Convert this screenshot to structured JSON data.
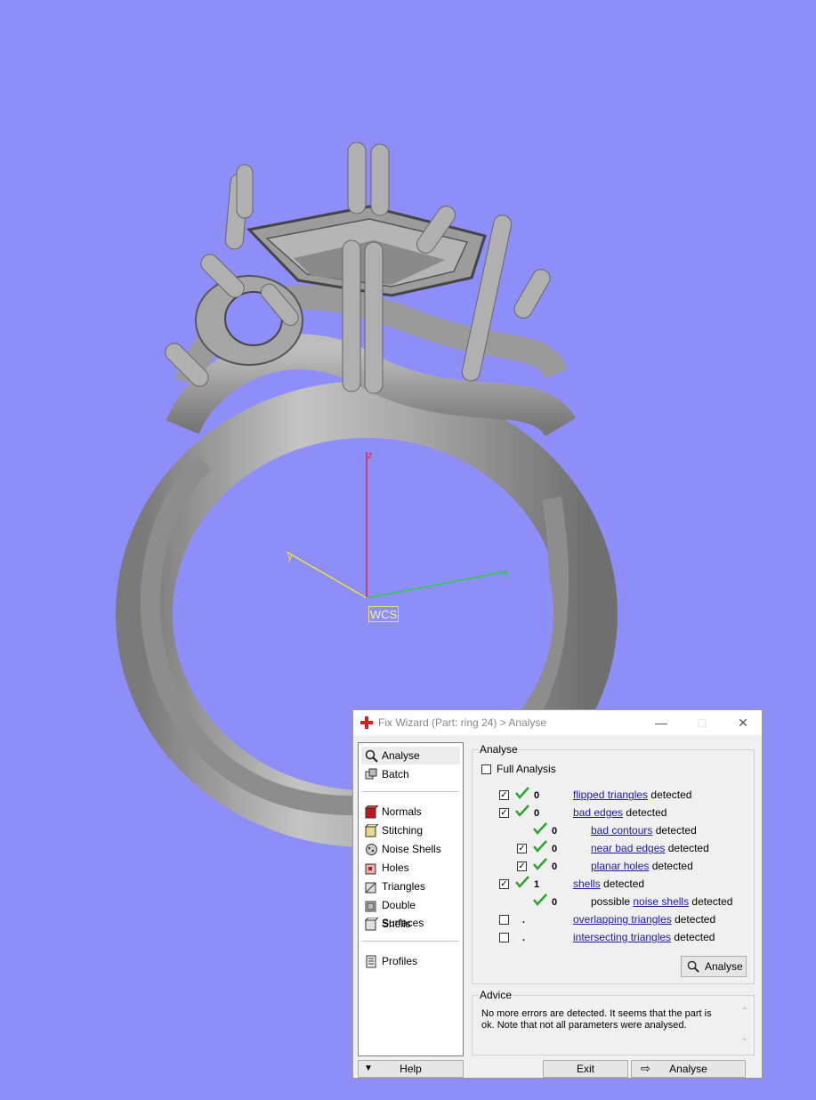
{
  "viewport": {
    "background_color": "#8e8ef8",
    "wcs_label": "WCS",
    "axis_z": "z",
    "axis_y": "y",
    "axis_x": "x"
  },
  "dialog": {
    "title": "Fix Wizard (Part: ring 24) > Analyse",
    "title_icon": "red-cross-icon",
    "nav": [
      {
        "label": "Analyse",
        "icon": "magnifier-icon",
        "selected": true
      },
      {
        "label": "Batch",
        "icon": "batch-icon"
      },
      {
        "label": "Normals",
        "icon": "normals-cube-icon"
      },
      {
        "label": "Stitching",
        "icon": "stitching-cube-icon"
      },
      {
        "label": "Noise Shells",
        "icon": "noise-shells-icon"
      },
      {
        "label": "Holes",
        "icon": "holes-cube-icon"
      },
      {
        "label": "Triangles",
        "icon": "triangles-cube-icon"
      },
      {
        "label": "Double Surfaces",
        "icon": "double-surfaces-icon"
      },
      {
        "label": "Shells",
        "icon": "shells-cube-icon"
      },
      {
        "label": "Profiles",
        "icon": "profiles-icon"
      }
    ],
    "analyse_group": {
      "legend": "Analyse",
      "full_analysis_label": "Full Analysis",
      "rows": [
        {
          "checked": true,
          "status": "ok",
          "count": "0",
          "link": "flipped triangles",
          "suffix": " detected"
        },
        {
          "checked": true,
          "status": "ok",
          "count": "0",
          "link": "bad edges",
          "suffix": " detected"
        },
        {
          "status": "ok",
          "count": "0",
          "link": "bad contours",
          "suffix": " detected"
        },
        {
          "checked": true,
          "status": "ok",
          "count": "0",
          "link": "near bad edges",
          "suffix": " detected"
        },
        {
          "checked": true,
          "status": "ok",
          "count": "0",
          "link": "planar holes",
          "suffix": " detected"
        },
        {
          "checked": true,
          "status": "ok",
          "count": "1",
          "link": "shells",
          "suffix": " detected"
        },
        {
          "status": "ok",
          "count": "0",
          "prefix": "possible ",
          "link": "noise shells",
          "suffix": " detected"
        },
        {
          "checked": false,
          "count": ".",
          "link": "overlapping triangles",
          "suffix": " detected"
        },
        {
          "checked": false,
          "count": ".",
          "link": "intersecting triangles",
          "suffix": " detected"
        }
      ],
      "analyse_button": "Analyse"
    },
    "advice_group": {
      "legend": "Advice",
      "text_line1": "No more errors are detected. It seems that the part is",
      "text_line2": "ok. Note that not all parameters were analysed."
    },
    "bottom": {
      "help_label": "Help",
      "exit_label": "Exit",
      "analyse_label": "Analyse"
    }
  }
}
